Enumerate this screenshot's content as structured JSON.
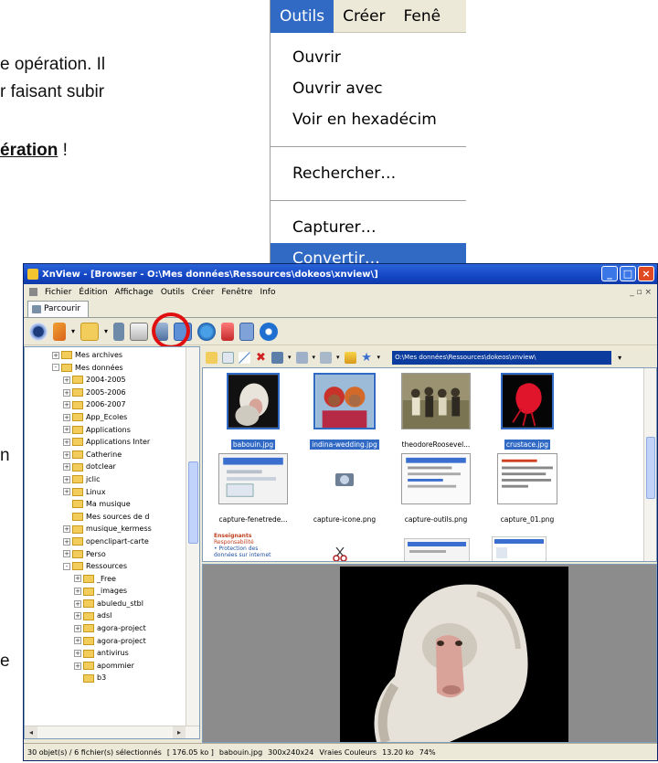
{
  "document": {
    "line1": "e opération. Il",
    "line2": "r faisant subir",
    "line3_bold": "ération",
    "line3_rest": " !",
    "line4": "n",
    "line5": "e"
  },
  "outils_menu": {
    "menubar": [
      "Outils",
      "Créer",
      "Fenê"
    ],
    "items_group1": [
      "Ouvrir",
      "Ouvrir avec",
      "Voir en hexadécim"
    ],
    "items_group2": [
      "Rechercher…"
    ],
    "items_group3": [
      "Capturer…",
      "Convertir…"
    ],
    "highlighted_color": "#316ac5"
  },
  "window": {
    "title": "XnView - [Browser - O:\\Mes données\\Ressources\\dokeos\\xnview\\]",
    "menu": [
      "Fichier",
      "Édition",
      "Affichage",
      "Outils",
      "Créer",
      "Fenêtre",
      "Info"
    ],
    "menu_controls": "_ ▫ ×",
    "tab_label": "Parcourir",
    "path": "O:\\Mes données\\Ressources\\dokeos\\xnview\\",
    "highlight_color": "#e01010",
    "tree": [
      {
        "label": "Mes archives",
        "indent": 1,
        "exp": "+"
      },
      {
        "label": "Mes données",
        "indent": 1,
        "exp": "-"
      },
      {
        "label": "2004-2005",
        "indent": 2,
        "exp": "+"
      },
      {
        "label": "2005-2006",
        "indent": 2,
        "exp": "+"
      },
      {
        "label": "2006-2007",
        "indent": 2,
        "exp": "+"
      },
      {
        "label": "App_Ecoles",
        "indent": 2,
        "exp": "+"
      },
      {
        "label": "Applications",
        "indent": 2,
        "exp": "+"
      },
      {
        "label": "Applications Inter",
        "indent": 2,
        "exp": "+"
      },
      {
        "label": "Catherine",
        "indent": 2,
        "exp": "+"
      },
      {
        "label": "dotclear",
        "indent": 2,
        "exp": "+"
      },
      {
        "label": "jclic",
        "indent": 2,
        "exp": "+"
      },
      {
        "label": "Linux",
        "indent": 2,
        "exp": "+"
      },
      {
        "label": "Ma musique",
        "indent": 2,
        "exp": ""
      },
      {
        "label": "Mes sources de d",
        "indent": 2,
        "exp": ""
      },
      {
        "label": "musique_kermess",
        "indent": 2,
        "exp": "+"
      },
      {
        "label": "openclipart-carte",
        "indent": 2,
        "exp": "+"
      },
      {
        "label": "Perso",
        "indent": 2,
        "exp": "+"
      },
      {
        "label": "Ressources",
        "indent": 2,
        "exp": "-"
      },
      {
        "label": "_Free",
        "indent": 3,
        "exp": "+"
      },
      {
        "label": "_images",
        "indent": 3,
        "exp": "+"
      },
      {
        "label": "abuledu_stbl",
        "indent": 3,
        "exp": "+"
      },
      {
        "label": "adsl",
        "indent": 3,
        "exp": "+"
      },
      {
        "label": "agora-project",
        "indent": 3,
        "exp": "+"
      },
      {
        "label": "agora-project",
        "indent": 3,
        "exp": "+"
      },
      {
        "label": "antivirus",
        "indent": 3,
        "exp": "+"
      },
      {
        "label": "apommier",
        "indent": 3,
        "exp": "+"
      },
      {
        "label": "b3",
        "indent": 3,
        "exp": ""
      }
    ],
    "thumbnails": [
      {
        "label": "babouin.jpg",
        "selected": true
      },
      {
        "label": "indina-wedding.jpg",
        "selected": true
      },
      {
        "label": "theodoreRoosevel...",
        "selected": false
      },
      {
        "label": "crustace.jpg",
        "selected": true
      },
      {
        "label": "capture-fenetrede...",
        "selected": false
      },
      {
        "label": "capture-icone.png",
        "selected": false
      },
      {
        "label": "capture-outils.png",
        "selected": false
      },
      {
        "label": "capture_01.png",
        "selected": false
      }
    ],
    "partial_thumb_text": [
      "Enseignants",
      "Responsabilité",
      "• Protection des",
      "données sur internet"
    ],
    "status": [
      "30 objet(s) / 6 fichier(s) sélectionnés",
      "[ 176.05 ko ]",
      "babouin.jpg",
      "300x240x24",
      "Vraies Couleurs",
      "13.20 ko",
      "74%"
    ]
  }
}
